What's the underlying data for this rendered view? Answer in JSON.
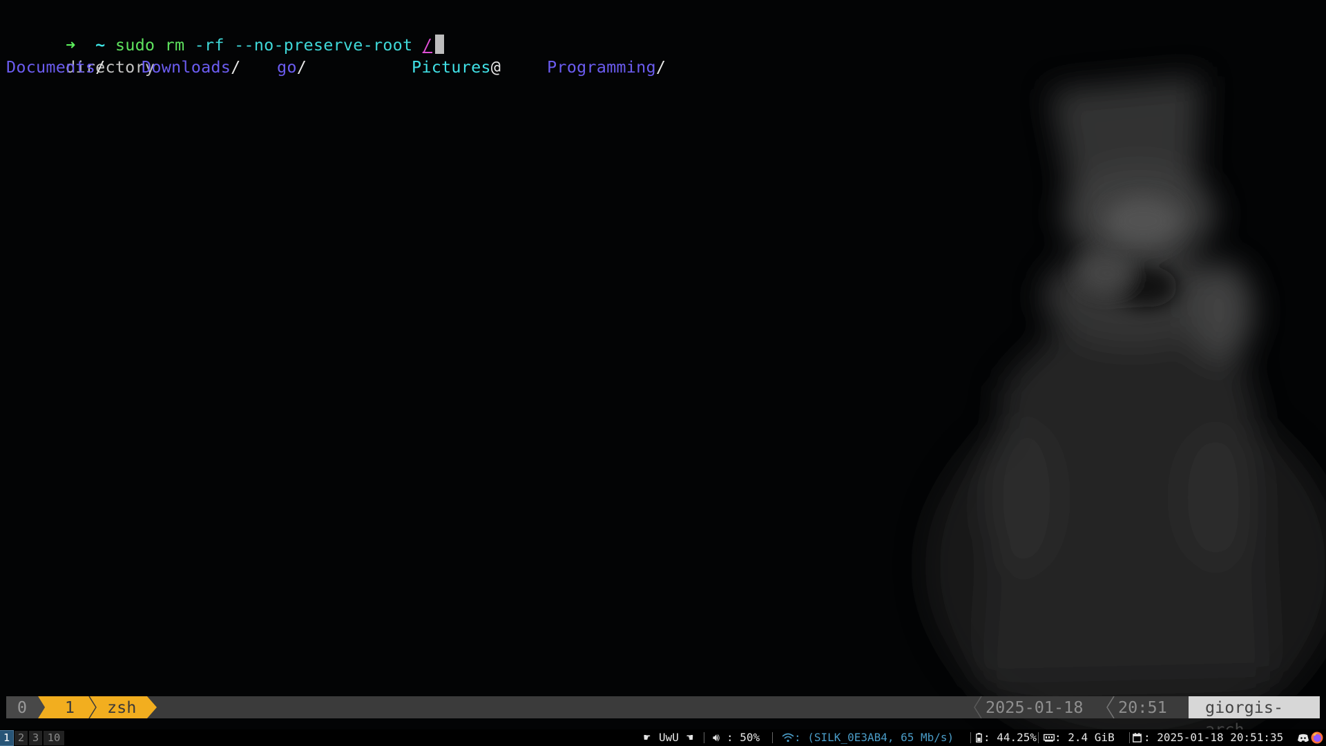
{
  "terminal": {
    "prompt_arrow": "➜",
    "prompt_dir": "~",
    "command": "sudo rm",
    "args": "-rf --no-preserve-root",
    "target": "/",
    "completion_label": "directory",
    "entries": [
      {
        "name": "Documents",
        "suffix": "/"
      },
      {
        "name": "Downloads",
        "suffix": "/"
      },
      {
        "name": "go",
        "suffix": "/"
      },
      {
        "name": "Pictures",
        "suffix": "@"
      },
      {
        "name": "Programming",
        "suffix": "/"
      }
    ]
  },
  "tmux": {
    "session": "0",
    "window_index": "1",
    "window_name": "zsh",
    "date": "2025-01-18",
    "time": "20:51",
    "host": "giorgis-arch"
  },
  "i3bar": {
    "workspaces": [
      "1",
      "2",
      "3",
      "10"
    ],
    "active_workspace": "1",
    "media": "UwU",
    "volume": ": 50%",
    "wifi": ": (SILK_0E3AB4, 65 Mb/s)",
    "battery": ": 44.25%",
    "memory": ": 2.4 GiB",
    "datetime": ": 2025-01-18 20:51:35"
  },
  "colors": {
    "background": "#030405",
    "tmux_accent": "#f2ae1f",
    "directory": "#6b5cf0",
    "symlink": "#40e0e6",
    "workspace_active": "#285577"
  },
  "icons": [
    "hand-pointing-right-icon",
    "hand-pointing-left-icon",
    "speaker-icon",
    "wifi-icon",
    "battery-icon",
    "memory-icon",
    "calendar-icon",
    "discord-icon",
    "firefox-icon"
  ]
}
